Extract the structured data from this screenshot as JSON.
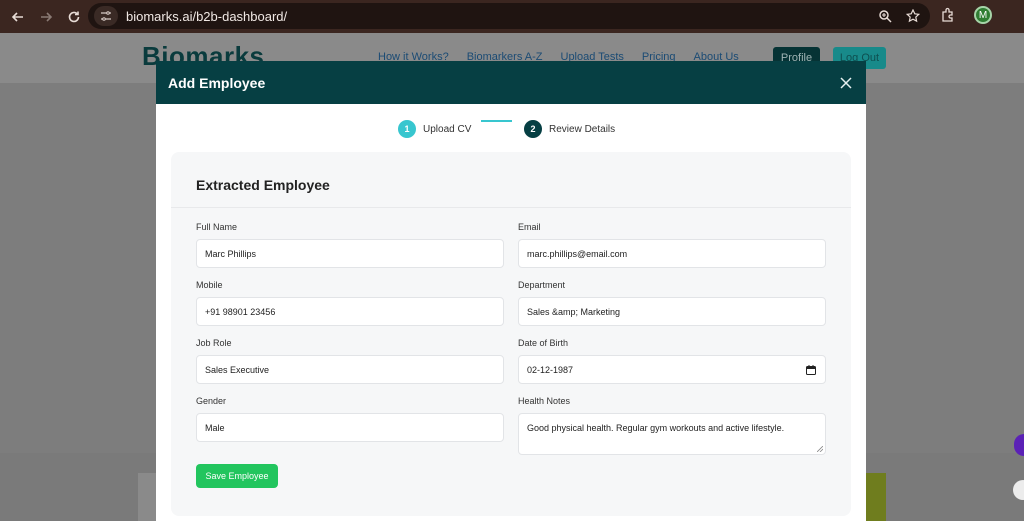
{
  "browser": {
    "url": "biomarks.ai/b2b-dashboard/",
    "profile_initial": "M"
  },
  "site": {
    "logo": "Biomarks",
    "nav": [
      "How it Works?",
      "Biomarkers A-Z",
      "Upload Tests",
      "Pricing",
      "About Us"
    ],
    "profile_label": "Profile",
    "logout_label": "Log Out"
  },
  "modal": {
    "title": "Add Employee",
    "steps": [
      {
        "number": "1",
        "label": "Upload CV"
      },
      {
        "number": "2",
        "label": "Review Details"
      }
    ],
    "section_title": "Extracted Employee",
    "fields": {
      "full_name": {
        "label": "Full Name",
        "value": "Marc Phillips"
      },
      "email": {
        "label": "Email",
        "value": "marc.phillips@email.com"
      },
      "mobile": {
        "label": "Mobile",
        "value": "+91 98901 23456"
      },
      "department": {
        "label": "Department",
        "value": "Sales &amp; Marketing"
      },
      "job_role": {
        "label": "Job Role",
        "value": "Sales Executive"
      },
      "dob": {
        "label": "Date of Birth",
        "value": "02-12-1987"
      },
      "gender": {
        "label": "Gender",
        "value": "Male"
      },
      "health_notes": {
        "label": "Health Notes",
        "value": "Good physical health. Regular gym workouts and active lifestyle."
      }
    },
    "save_label": "Save Employee"
  },
  "colors": {
    "modal_header": "#063f43",
    "step_active": "#38c6cf",
    "step_current": "#063f43",
    "save_button": "#22c55e"
  }
}
